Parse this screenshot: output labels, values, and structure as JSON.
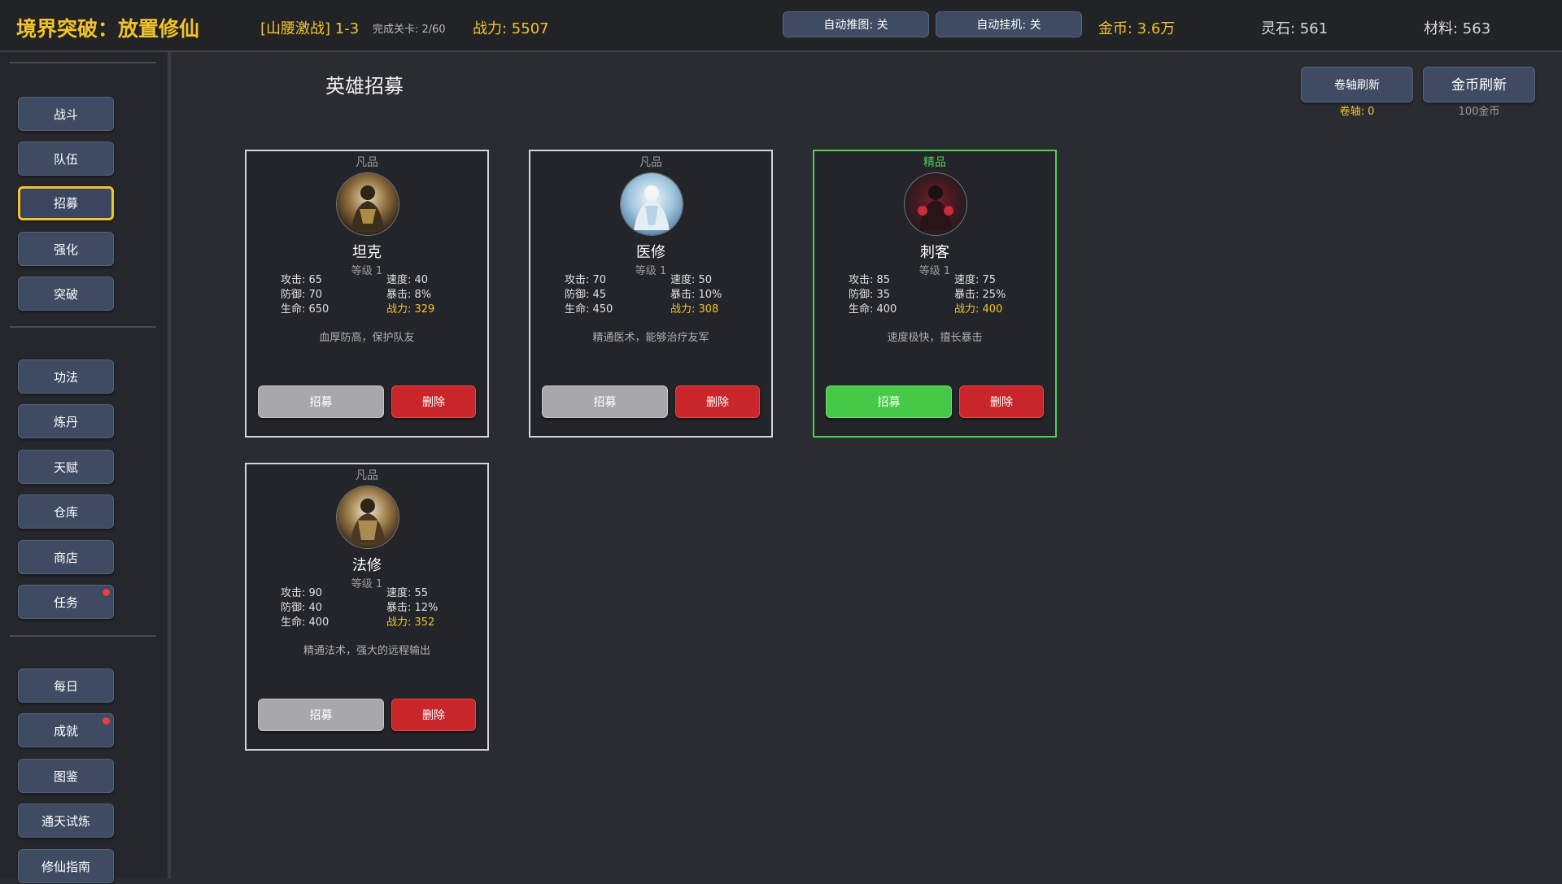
{
  "header": {
    "game_title": "境界突破：放置修仙",
    "stage": "[山腰激战] 1-3",
    "progress": "完成关卡: 2/60",
    "power": "战力: 5507",
    "auto_advance": "自动推图: 关",
    "auto_idle": "自动挂机: 关",
    "gold": "金币: 3.6万",
    "spirit_stone": "灵石: 561",
    "materials": "材料: 563"
  },
  "sidebar": {
    "group1": [
      "战斗",
      "队伍",
      "招募",
      "强化",
      "突破"
    ],
    "group2": [
      "功法",
      "炼丹",
      "天赋",
      "仓库",
      "商店",
      "任务"
    ],
    "group3": [
      "每日",
      "成就",
      "图鉴",
      "通天试炼",
      "修仙指南"
    ],
    "active": "招募"
  },
  "main": {
    "title": "英雄招募",
    "scroll_refresh": {
      "label": "卷轴刷新",
      "sub": "卷轴: 0"
    },
    "gold_refresh": {
      "label": "金币刷新",
      "sub": "100金币"
    }
  },
  "heroes": [
    {
      "rarity": "凡品",
      "name": "坦克",
      "level": "等级 1",
      "atk": "攻击: 65",
      "spd": "速度: 40",
      "def": "防御: 70",
      "crit": "暴击: 8%",
      "hp": "生命: 650",
      "power": "战力: 329",
      "desc": "血厚防高，保护队友",
      "recruit": "招募",
      "delete": "删除"
    },
    {
      "rarity": "凡品",
      "name": "医修",
      "level": "等级 1",
      "atk": "攻击: 70",
      "spd": "速度: 50",
      "def": "防御: 45",
      "crit": "暴击: 10%",
      "hp": "生命: 450",
      "power": "战力: 308",
      "desc": "精通医术，能够治疗友军",
      "recruit": "招募",
      "delete": "删除"
    },
    {
      "rarity": "精品",
      "name": "刺客",
      "level": "等级 1",
      "atk": "攻击: 85",
      "spd": "速度: 75",
      "def": "防御: 35",
      "crit": "暴击: 25%",
      "hp": "生命: 400",
      "power": "战力: 400",
      "desc": "速度极快，擅长暴击",
      "recruit": "招募",
      "delete": "删除"
    },
    {
      "rarity": "凡品",
      "name": "法修",
      "level": "等级 1",
      "atk": "攻击: 90",
      "spd": "速度: 55",
      "def": "防御: 40",
      "crit": "暴击: 12%",
      "hp": "生命: 400",
      "power": "战力: 352",
      "desc": "精通法术，强大的远程输出",
      "recruit": "招募",
      "delete": "删除"
    }
  ],
  "colors": {
    "gold": "#f2c22b",
    "elite": "#4ed24e",
    "delete": "#c9262b",
    "nav": "#3e4b62"
  }
}
